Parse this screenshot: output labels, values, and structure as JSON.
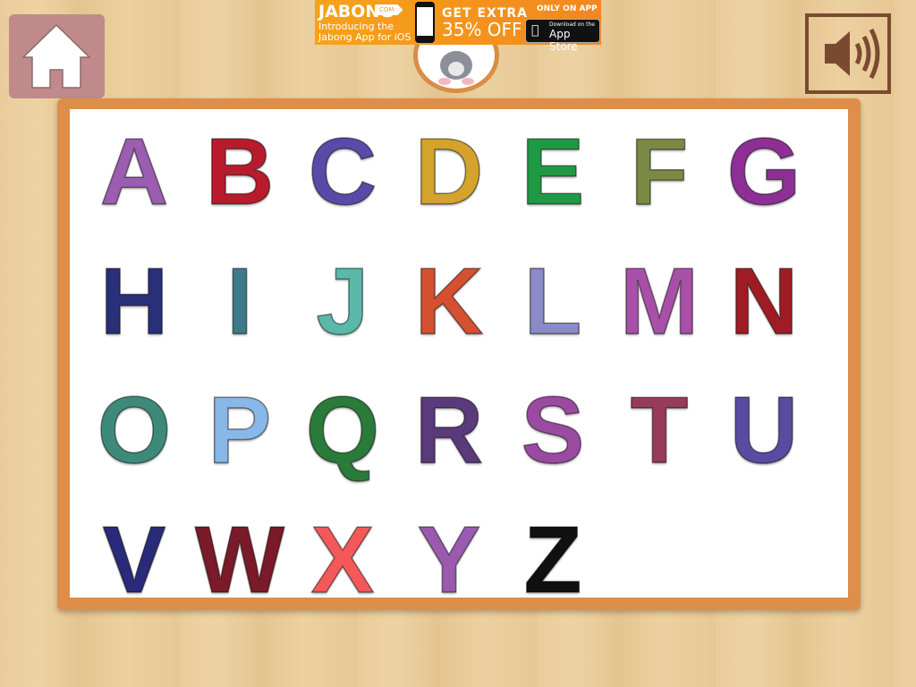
{
  "ad": {
    "brand": "JABONG",
    "com": "COM",
    "line1": "Introducing the",
    "line2": "Jabong App for iOS",
    "get": "GET EXTRA",
    "off": "35% OFF",
    "only": "ONLY ON APP",
    "download": "Download on the",
    "store": "App Store"
  },
  "icons": {
    "home": "home-icon",
    "sound": "speaker-icon",
    "mascot": "cat-mascot"
  },
  "letters": [
    {
      "char": "A",
      "color": "#9a5db0"
    },
    {
      "char": "B",
      "color": "#b81c2c"
    },
    {
      "char": "C",
      "color": "#5a4aa8"
    },
    {
      "char": "D",
      "color": "#d4a32c"
    },
    {
      "char": "E",
      "color": "#1f9a44"
    },
    {
      "char": "F",
      "color": "#7a8a44"
    },
    {
      "char": "G",
      "color": "#8e2f96"
    },
    {
      "char": "H",
      "color": "#2a2f7a"
    },
    {
      "char": "I",
      "color": "#3e7a8a"
    },
    {
      "char": "J",
      "color": "#5ab8a8"
    },
    {
      "char": "K",
      "color": "#d45030"
    },
    {
      "char": "L",
      "color": "#8a8ac8"
    },
    {
      "char": "M",
      "color": "#a850a8"
    },
    {
      "char": "N",
      "color": "#a01c24"
    },
    {
      "char": "O",
      "color": "#3e8a7a"
    },
    {
      "char": "P",
      "color": "#88b8e8"
    },
    {
      "char": "Q",
      "color": "#2a7a3a"
    },
    {
      "char": "R",
      "color": "#5a3a7a"
    },
    {
      "char": "S",
      "color": "#9a4aa0"
    },
    {
      "char": "T",
      "color": "#983a5a"
    },
    {
      "char": "U",
      "color": "#5a4aa0"
    },
    {
      "char": "V",
      "color": "#2a2a7a"
    },
    {
      "char": "W",
      "color": "#7a1a2a"
    },
    {
      "char": "X",
      "color": "#f45858"
    },
    {
      "char": "Y",
      "color": "#9a5ab0"
    },
    {
      "char": "Z",
      "color": "#101010"
    }
  ]
}
